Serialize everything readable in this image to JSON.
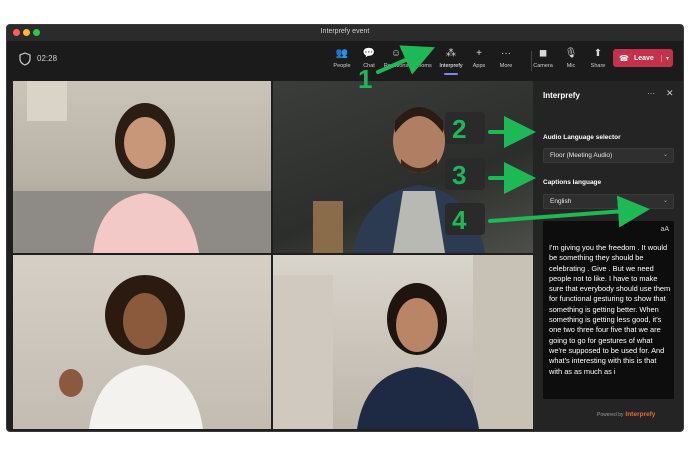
{
  "window": {
    "title": "Interprefy event"
  },
  "toolbar": {
    "timer": "02:28",
    "tools": [
      {
        "label": "People",
        "icon": "people-icon",
        "glyph": "👥"
      },
      {
        "label": "Chat",
        "icon": "chat-icon",
        "glyph": "💬"
      },
      {
        "label": "Reactions",
        "icon": "reactions-icon",
        "glyph": "☺"
      },
      {
        "label": "Rooms",
        "icon": "rooms-icon",
        "glyph": "▢"
      },
      {
        "label": "Interprefy",
        "icon": "interprefy-icon",
        "glyph": "⁂"
      },
      {
        "label": "Apps",
        "icon": "apps-icon",
        "glyph": "+"
      },
      {
        "label": "More",
        "icon": "more-icon",
        "glyph": "···"
      },
      {
        "label": "Camera",
        "icon": "camera-off-icon",
        "glyph": "◼"
      },
      {
        "label": "Mic",
        "icon": "mic-icon",
        "glyph": "🎙"
      },
      {
        "label": "Share",
        "icon": "share-icon",
        "glyph": "⬆"
      }
    ],
    "leave_label": "Leave"
  },
  "panel": {
    "title": "Interprefy",
    "audio_label": "Audio Language selector",
    "audio_value": "Floor (Meeting Audio)",
    "captions_label": "Captions language",
    "captions_value": "English",
    "font_size_toggle": "aA",
    "captions_text": "I'm giving you the freedom . It would be something they should be celebrating . Give . But we need people not to like. I have to make sure that everybody should use them for functional gesturing to show that something is getting better. When something is getting less good, it's one two three four five that we are going to go for gestures of what we're supposed to be used for. And what's interesting with this is that with as as much as i",
    "powered_by": "Powered by",
    "brand": "Interprefy"
  },
  "callouts": [
    "1",
    "2",
    "3",
    "4"
  ],
  "colors": {
    "accent_green": "#1db954",
    "leave_red": "#c4314b",
    "panel_bg": "#242424",
    "brand_orange": "#e56a3f"
  }
}
